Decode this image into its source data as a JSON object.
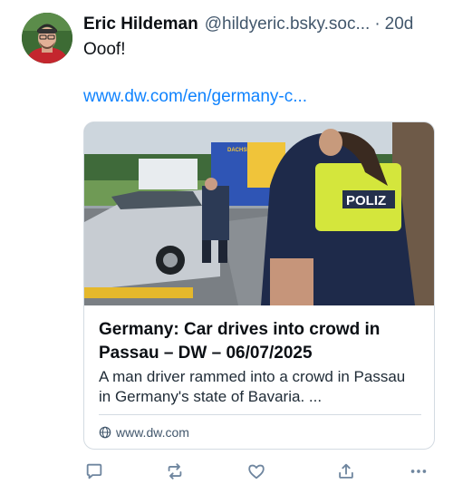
{
  "post": {
    "author": {
      "display_name": "Eric Hildeman",
      "handle": "@hildyeric.bsky.soc...",
      "separator": "·",
      "time": "20d"
    },
    "text": "Ooof!",
    "link_text": "www.dw.com/en/germany-c..."
  },
  "card": {
    "title": "Germany: Car drives into crowd in Passau – DW – 06/07/2025",
    "description": "A man driver rammed into a crowd in Passau in Germany's state of Bavaria. ...",
    "domain": "www.dw.com",
    "image_text": {
      "police_label": "POLIZ",
      "truck_label": "DACHSER"
    }
  },
  "icons": {
    "reply": "reply-icon",
    "repost": "repost-icon",
    "like": "heart-icon",
    "share": "share-icon",
    "more": "more-icon",
    "globe": "globe-icon"
  },
  "colors": {
    "link": "#1083fe",
    "muted": "#42576c",
    "icon": "#6f869f",
    "border": "#d4dbe2"
  }
}
